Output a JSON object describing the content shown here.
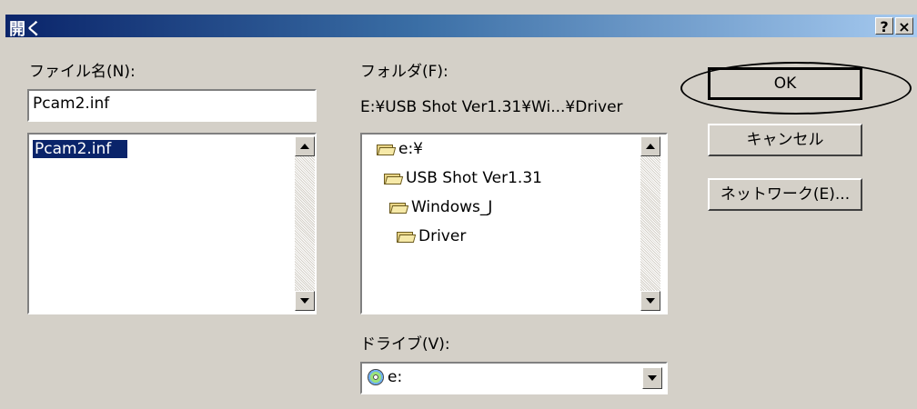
{
  "window": {
    "title": "開く",
    "help_button": "?",
    "close_button": "×"
  },
  "filename": {
    "label": "ファイル名(N):",
    "value": "Pcam2.inf",
    "list": [
      "Pcam2.inf"
    ]
  },
  "folder": {
    "label": "フォルダ(F):",
    "path": "E:¥USB Shot Ver1.31¥Wi...¥Driver",
    "tree": [
      "e:¥",
      "USB Shot Ver1.31",
      "Windows_J",
      "Driver"
    ]
  },
  "drive": {
    "label": "ドライブ(V):",
    "value": "e:"
  },
  "buttons": {
    "ok": "OK",
    "cancel": "キャンセル",
    "network": "ネットワーク(E)..."
  },
  "icons": {
    "folder": "folder-icon",
    "cd": "cd-drive-icon"
  }
}
